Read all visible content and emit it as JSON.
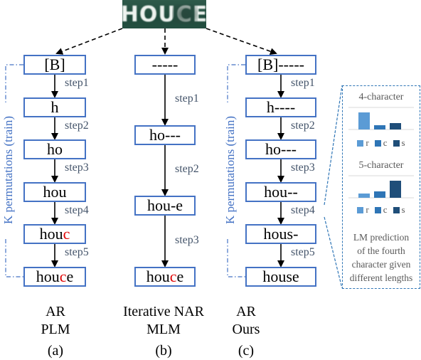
{
  "input_image": {
    "word": "HOUCE",
    "description": "scene text image of the word HOUSE with occluded S"
  },
  "columns": [
    {
      "id": "a",
      "boxes": [
        {
          "text": "[B]",
          "red_index": null
        },
        {
          "text": "h",
          "red_index": null
        },
        {
          "text": "ho",
          "red_index": null
        },
        {
          "text": "hou",
          "red_index": null
        },
        {
          "text": "houc",
          "red_index": 3
        },
        {
          "text": "houce",
          "red_index": 3
        }
      ],
      "steps": [
        "step1",
        "step2",
        "step3",
        "step4",
        "step5"
      ],
      "side_label": "K permutations (train)",
      "caption_line1": "AR",
      "caption_line2": "PLM",
      "caption_tag": "(a)"
    },
    {
      "id": "b",
      "boxes": [
        {
          "text": "-----",
          "red_index": null
        },
        {
          "text": "ho---",
          "red_index": null
        },
        {
          "text": "hou-e",
          "red_index": null
        },
        {
          "text": "houce",
          "red_index": 3
        }
      ],
      "steps": [
        "step1",
        "step2",
        "step3"
      ],
      "caption_line1": "Iterative NAR",
      "caption_line2": "MLM",
      "caption_tag": "(b)"
    },
    {
      "id": "c",
      "boxes": [
        {
          "text": "[B]-----",
          "red_index": null
        },
        {
          "text": "h----",
          "red_index": null
        },
        {
          "text": "ho---",
          "red_index": null
        },
        {
          "text": "hou--",
          "red_index": null
        },
        {
          "text": "hous-",
          "red_index": null
        },
        {
          "text": "house",
          "red_index": null
        }
      ],
      "steps": [
        "step1",
        "step2",
        "step3",
        "step4",
        "step5"
      ],
      "side_label": "K permutations (train)",
      "caption_line1": "AR",
      "caption_line2": "Ours",
      "caption_tag": "(c)"
    }
  ],
  "inset_panel": {
    "charts": [
      {
        "title": "4-character",
        "legend": [
          "r",
          "c",
          "s"
        ],
        "values": [
          0.8,
          0.2,
          0.3
        ]
      },
      {
        "title": "5-character",
        "legend": [
          "r",
          "c",
          "s"
        ],
        "values": [
          0.2,
          0.3,
          0.8
        ]
      }
    ],
    "description_lines": [
      "LM prediction",
      "of the fourth",
      "character given",
      "different lengths"
    ]
  },
  "colors": {
    "box_border": "#4472c4",
    "highlight_char": "#e00000",
    "step_text": "#44546a",
    "side_label": "#4472c4",
    "panel_border": "#2e75b6",
    "bar_r": "#5b9bd5",
    "bar_c": "#2e75b6",
    "bar_s": "#1f4e79"
  },
  "chart_data": [
    {
      "type": "bar",
      "title": "4-character",
      "categories": [
        "r",
        "c",
        "s"
      ],
      "values": [
        0.8,
        0.2,
        0.3
      ],
      "xlabel": "",
      "ylabel": "",
      "ylim": [
        0,
        1
      ],
      "legend": "bottom"
    },
    {
      "type": "bar",
      "title": "5-character",
      "categories": [
        "r",
        "c",
        "s"
      ],
      "values": [
        0.2,
        0.3,
        0.8
      ],
      "xlabel": "",
      "ylabel": "",
      "ylim": [
        0,
        1
      ],
      "legend": "bottom"
    }
  ]
}
